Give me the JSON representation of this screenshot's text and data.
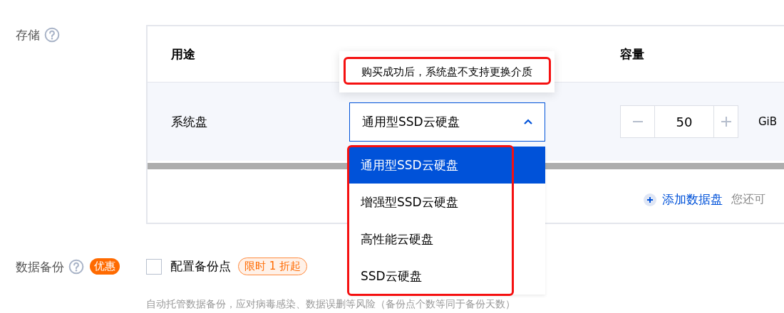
{
  "storage": {
    "label": "存储",
    "table": {
      "columns": [
        "用途",
        "容量"
      ],
      "row": {
        "usage": "系统盘",
        "disk_type": {
          "value": "通用型SSD云硬盘",
          "expanded": true
        },
        "capacity": {
          "value": "50",
          "unit": "GiB"
        }
      },
      "add_data_disk": "添加数据盘",
      "add_hint": "您还可"
    },
    "tooltip": "购买成功后，系统盘不支持更换介质",
    "dropdown_options": [
      {
        "label": "通用型SSD云硬盘",
        "selected": true
      },
      {
        "label": "增强型SSD云硬盘",
        "selected": false
      },
      {
        "label": "高性能云硬盘",
        "selected": false
      },
      {
        "label": "SSD云硬盘",
        "selected": false
      }
    ]
  },
  "backup": {
    "label": "数据备份",
    "badge": "优惠",
    "checkbox": {
      "label": "配置备份点",
      "checked": false
    },
    "promo": "限时 1 折起",
    "description": "自动托管数据备份，应对病毒感染、数据误删等风险（备份点个数等同于备份天数）"
  }
}
